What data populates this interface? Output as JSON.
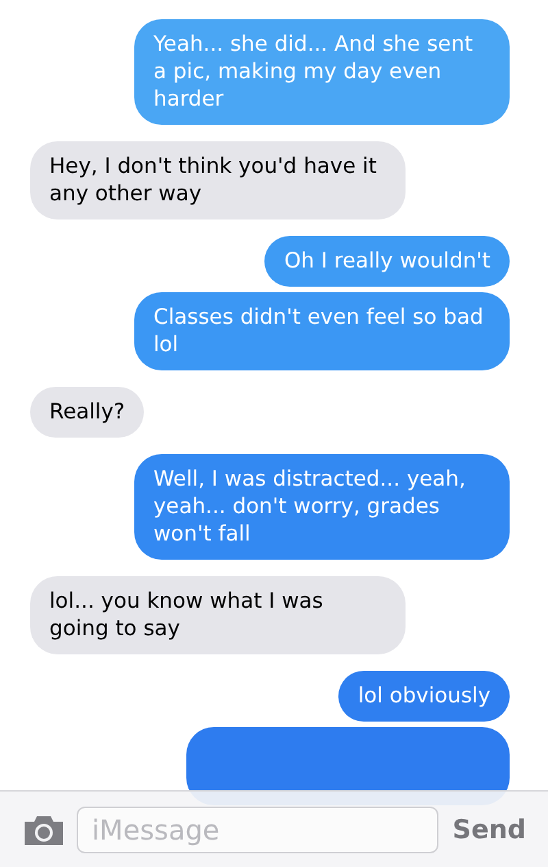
{
  "messages": [
    {
      "kind": "sent",
      "text": "Yeah... she did... And she sent a pic, making my day even harder",
      "color": "#4aa6f4"
    },
    {
      "kind": "received",
      "text": "Hey, I don't think you'd have it any other way"
    },
    {
      "kind": "sent",
      "text": "Oh I really wouldn't",
      "color": "#3e9bf4"
    },
    {
      "kind": "sent",
      "text": "Classes didn't even feel so bad lol",
      "color": "#3b97f4"
    },
    {
      "kind": "received",
      "text": "Really?"
    },
    {
      "kind": "sent",
      "text": "Well, I was distracted... yeah, yeah... don't worry, grades won't fall",
      "color": "#3389f2"
    },
    {
      "kind": "received",
      "text": "lol... you know what I was going to say"
    },
    {
      "kind": "sent",
      "text": "lol obviously",
      "color": "#2f7ff0"
    },
    {
      "kind": "sent",
      "color": "#2e7cef"
    }
  ],
  "composer": {
    "placeholder": "iMessage",
    "send": "Send"
  }
}
